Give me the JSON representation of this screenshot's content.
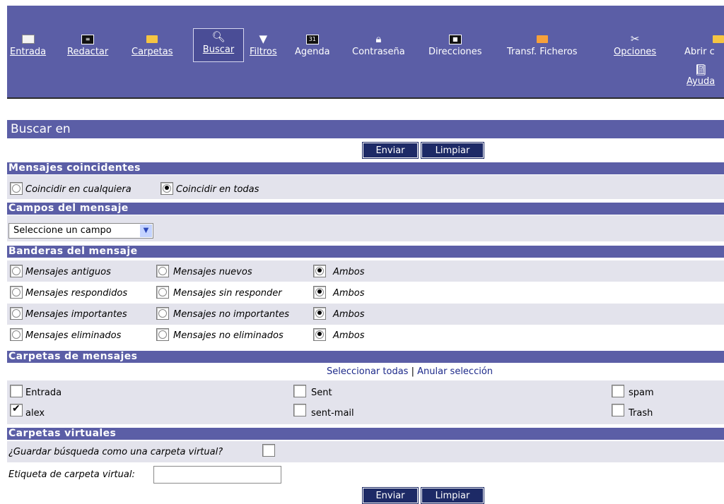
{
  "toolbar": {
    "items": [
      {
        "label": "Entrada",
        "icon": "envelope-icon"
      },
      {
        "label": "Redactar",
        "icon": "compose-icon"
      },
      {
        "label": "Carpetas",
        "icon": "folder-icon"
      },
      {
        "label": "Buscar",
        "icon": "search-icon"
      },
      {
        "label": "Filtros",
        "icon": "filter-icon"
      },
      {
        "label": "Agenda",
        "icon": "calendar-icon",
        "icon_text": "31"
      },
      {
        "label": "Contraseña",
        "icon": "lock-icon"
      },
      {
        "label": "Direcciones",
        "icon": "address-book-icon"
      },
      {
        "label": "Transf. Ficheros",
        "icon": "file-transfer-icon"
      },
      {
        "label": "Opciones",
        "icon": "tools-icon"
      },
      {
        "label": "Abrir c",
        "icon": "open-folder-icon"
      },
      {
        "label": "Ayuda",
        "icon": "help-book-icon"
      }
    ]
  },
  "page_title": "Buscar en",
  "buttons": {
    "submit": "Enviar",
    "reset": "Limpiar"
  },
  "sections": {
    "match": "Mensajes coincidentes",
    "fields": "Campos del mensaje",
    "flags": "Banderas del mensaje",
    "folders": "Carpetas de mensajes",
    "virtual": "Carpetas virtuales"
  },
  "match": {
    "any": "Coincidir en cualquiera",
    "all": "Coincidir en todas",
    "selected": "all"
  },
  "fields": {
    "select_value": "Seleccione un campo"
  },
  "flags": [
    {
      "a": "Mensajes antiguos",
      "b": "Mensajes nuevos",
      "c": "Ambos",
      "selected": "c"
    },
    {
      "a": "Mensajes respondidos",
      "b": "Mensajes sin responder",
      "c": "Ambos",
      "selected": "c"
    },
    {
      "a": "Mensajes importantes",
      "b": "Mensajes no importantes",
      "c": "Ambos",
      "selected": "c"
    },
    {
      "a": "Mensajes eliminados",
      "b": "Mensajes no eliminados",
      "c": "Ambos",
      "selected": "c"
    }
  ],
  "folders": {
    "select_all": "Seleccionar todas",
    "separator": "|",
    "deselect": "Anular selección",
    "list": [
      {
        "name": "Entrada",
        "checked": false
      },
      {
        "name": "Sent",
        "checked": false
      },
      {
        "name": "spam",
        "checked": false
      },
      {
        "name": "alex",
        "checked": true
      },
      {
        "name": "sent-mail",
        "checked": false
      },
      {
        "name": "Trash",
        "checked": false
      }
    ]
  },
  "virtual": {
    "save_label": "¿Guardar búsqueda como una carpeta virtual?",
    "save_checked": false,
    "label_label": "Etiqueta de carpeta virtual:",
    "label_value": ""
  },
  "colors": {
    "accent": "#5b5ea6",
    "button": "#1d2a66",
    "row": "#e3e3ec"
  }
}
